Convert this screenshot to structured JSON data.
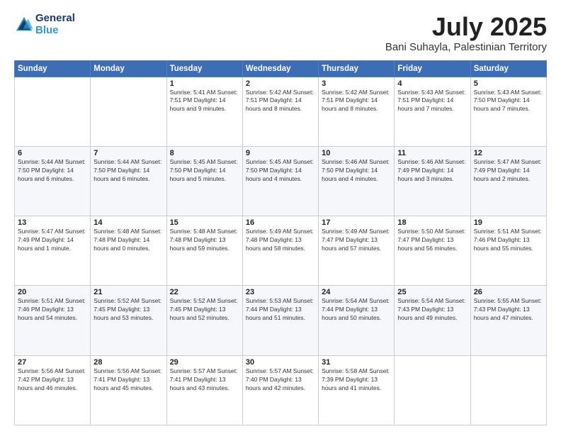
{
  "header": {
    "logo_line1": "General",
    "logo_line2": "Blue",
    "month": "July 2025",
    "location": "Bani Suhayla, Palestinian Territory"
  },
  "weekdays": [
    "Sunday",
    "Monday",
    "Tuesday",
    "Wednesday",
    "Thursday",
    "Friday",
    "Saturday"
  ],
  "weeks": [
    [
      {
        "day": "",
        "info": ""
      },
      {
        "day": "",
        "info": ""
      },
      {
        "day": "1",
        "info": "Sunrise: 5:41 AM\nSunset: 7:51 PM\nDaylight: 14 hours and 9 minutes."
      },
      {
        "day": "2",
        "info": "Sunrise: 5:42 AM\nSunset: 7:51 PM\nDaylight: 14 hours and 8 minutes."
      },
      {
        "day": "3",
        "info": "Sunrise: 5:42 AM\nSunset: 7:51 PM\nDaylight: 14 hours and 8 minutes."
      },
      {
        "day": "4",
        "info": "Sunrise: 5:43 AM\nSunset: 7:51 PM\nDaylight: 14 hours and 7 minutes."
      },
      {
        "day": "5",
        "info": "Sunrise: 5:43 AM\nSunset: 7:50 PM\nDaylight: 14 hours and 7 minutes."
      }
    ],
    [
      {
        "day": "6",
        "info": "Sunrise: 5:44 AM\nSunset: 7:50 PM\nDaylight: 14 hours and 6 minutes."
      },
      {
        "day": "7",
        "info": "Sunrise: 5:44 AM\nSunset: 7:50 PM\nDaylight: 14 hours and 6 minutes."
      },
      {
        "day": "8",
        "info": "Sunrise: 5:45 AM\nSunset: 7:50 PM\nDaylight: 14 hours and 5 minutes."
      },
      {
        "day": "9",
        "info": "Sunrise: 5:45 AM\nSunset: 7:50 PM\nDaylight: 14 hours and 4 minutes."
      },
      {
        "day": "10",
        "info": "Sunrise: 5:46 AM\nSunset: 7:50 PM\nDaylight: 14 hours and 4 minutes."
      },
      {
        "day": "11",
        "info": "Sunrise: 5:46 AM\nSunset: 7:49 PM\nDaylight: 14 hours and 3 minutes."
      },
      {
        "day": "12",
        "info": "Sunrise: 5:47 AM\nSunset: 7:49 PM\nDaylight: 14 hours and 2 minutes."
      }
    ],
    [
      {
        "day": "13",
        "info": "Sunrise: 5:47 AM\nSunset: 7:49 PM\nDaylight: 14 hours and 1 minute."
      },
      {
        "day": "14",
        "info": "Sunrise: 5:48 AM\nSunset: 7:48 PM\nDaylight: 14 hours and 0 minutes."
      },
      {
        "day": "15",
        "info": "Sunrise: 5:48 AM\nSunset: 7:48 PM\nDaylight: 13 hours and 59 minutes."
      },
      {
        "day": "16",
        "info": "Sunrise: 5:49 AM\nSunset: 7:48 PM\nDaylight: 13 hours and 58 minutes."
      },
      {
        "day": "17",
        "info": "Sunrise: 5:49 AM\nSunset: 7:47 PM\nDaylight: 13 hours and 57 minutes."
      },
      {
        "day": "18",
        "info": "Sunrise: 5:50 AM\nSunset: 7:47 PM\nDaylight: 13 hours and 56 minutes."
      },
      {
        "day": "19",
        "info": "Sunrise: 5:51 AM\nSunset: 7:46 PM\nDaylight: 13 hours and 55 minutes."
      }
    ],
    [
      {
        "day": "20",
        "info": "Sunrise: 5:51 AM\nSunset: 7:46 PM\nDaylight: 13 hours and 54 minutes."
      },
      {
        "day": "21",
        "info": "Sunrise: 5:52 AM\nSunset: 7:45 PM\nDaylight: 13 hours and 53 minutes."
      },
      {
        "day": "22",
        "info": "Sunrise: 5:52 AM\nSunset: 7:45 PM\nDaylight: 13 hours and 52 minutes."
      },
      {
        "day": "23",
        "info": "Sunrise: 5:53 AM\nSunset: 7:44 PM\nDaylight: 13 hours and 51 minutes."
      },
      {
        "day": "24",
        "info": "Sunrise: 5:54 AM\nSunset: 7:44 PM\nDaylight: 13 hours and 50 minutes."
      },
      {
        "day": "25",
        "info": "Sunrise: 5:54 AM\nSunset: 7:43 PM\nDaylight: 13 hours and 49 minutes."
      },
      {
        "day": "26",
        "info": "Sunrise: 5:55 AM\nSunset: 7:43 PM\nDaylight: 13 hours and 47 minutes."
      }
    ],
    [
      {
        "day": "27",
        "info": "Sunrise: 5:56 AM\nSunset: 7:42 PM\nDaylight: 13 hours and 46 minutes."
      },
      {
        "day": "28",
        "info": "Sunrise: 5:56 AM\nSunset: 7:41 PM\nDaylight: 13 hours and 45 minutes."
      },
      {
        "day": "29",
        "info": "Sunrise: 5:57 AM\nSunset: 7:41 PM\nDaylight: 13 hours and 43 minutes."
      },
      {
        "day": "30",
        "info": "Sunrise: 5:57 AM\nSunset: 7:40 PM\nDaylight: 13 hours and 42 minutes."
      },
      {
        "day": "31",
        "info": "Sunrise: 5:58 AM\nSunset: 7:39 PM\nDaylight: 13 hours and 41 minutes."
      },
      {
        "day": "",
        "info": ""
      },
      {
        "day": "",
        "info": ""
      }
    ]
  ]
}
